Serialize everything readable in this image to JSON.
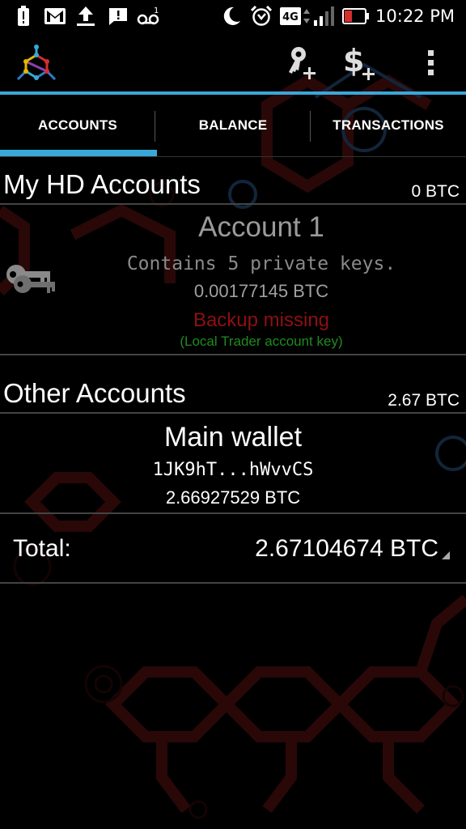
{
  "status_bar": {
    "time": "10:22 PM",
    "network_badge": "4G",
    "icons": [
      "alert-icon",
      "gmail-icon",
      "upload-icon",
      "chat-alert-icon",
      "voicemail-icon",
      "moon-icon",
      "alarm-icon",
      "signal-icon",
      "battery-low-icon"
    ],
    "battery_color": "#d32f2f"
  },
  "action_bar": {
    "logo": "mycelium-logo",
    "actions": [
      "add-key-icon",
      "add-dollar-icon",
      "overflow-menu-icon"
    ]
  },
  "tabs": [
    {
      "label": "ACCOUNTS",
      "selected": true
    },
    {
      "label": "BALANCE",
      "selected": false
    },
    {
      "label": "TRANSACTIONS",
      "selected": false
    }
  ],
  "hd_section": {
    "title": "My HD Accounts",
    "balance": "0 BTC"
  },
  "hd_account": {
    "name": "Account 1",
    "keys_text": "Contains 5 private keys.",
    "balance": "0.00177145 BTC",
    "warning": "Backup missing",
    "note": "(Local Trader account key)"
  },
  "other_section": {
    "title": "Other Accounts",
    "balance": "2.67 BTC"
  },
  "other_account": {
    "name": "Main wallet",
    "address": "1JK9hT...hWvvCS",
    "balance": "2.66927529 BTC"
  },
  "total": {
    "label": "Total:",
    "value": "2.67104674 BTC"
  },
  "colors": {
    "accent": "#3aa7d9",
    "warning": "#8e1010",
    "note": "#1f8b1f",
    "background": "#000000"
  }
}
